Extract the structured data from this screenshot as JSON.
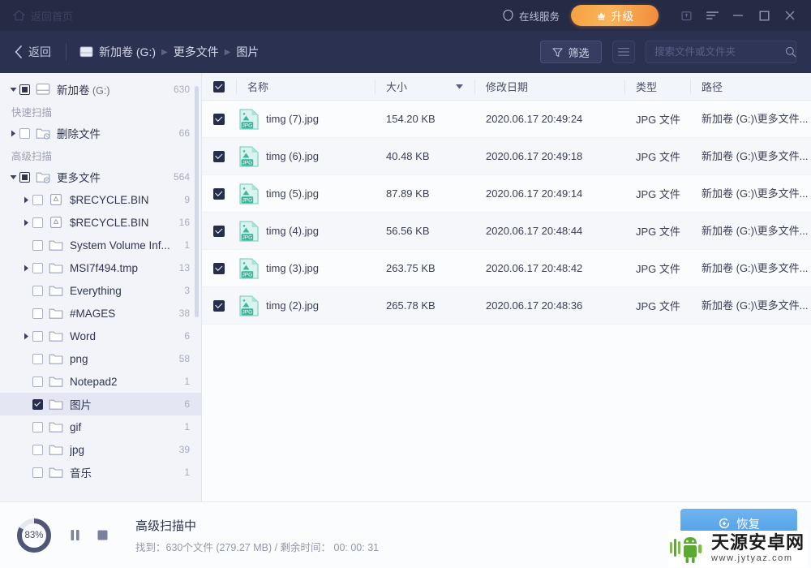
{
  "titlebar": {
    "home_label": "返回首页",
    "home_icon": "home-icon",
    "service_label": "在线服务",
    "service_icon": "headset-icon",
    "upgrade_label": "升级",
    "upgrade_icon": "crown-upgrade-icon",
    "window_buttons": [
      {
        "name": "feedback-icon",
        "label": ""
      },
      {
        "name": "menu-icon",
        "label": ""
      },
      {
        "name": "minimize-icon",
        "label": ""
      },
      {
        "name": "maximize-icon",
        "label": ""
      },
      {
        "name": "close-icon",
        "label": ""
      }
    ]
  },
  "navbar": {
    "back_label": "返回",
    "back_icon": "chevron-left-icon",
    "drive_icon": "drive-icon",
    "breadcrumbs": [
      "新加卷 (G:)",
      "更多文件",
      "图片"
    ],
    "separator": "▸",
    "filter_label": "筛选",
    "filter_icon": "funnel-icon",
    "viewmode_icon": "list-view-icon",
    "search_placeholder": "搜索文件或文件夹",
    "search_value": "",
    "search_icon": "search-icon"
  },
  "sidebar": {
    "scroll_thumb": true,
    "nodes": [
      {
        "type": "node",
        "indent": 0,
        "caret": "down",
        "check": "partial",
        "icon": "drive-icon",
        "label": "新加卷",
        "sub": " (G:)",
        "count": "630",
        "selected": false
      },
      {
        "type": "section",
        "label": "快速扫描"
      },
      {
        "type": "node",
        "indent": 0,
        "caret": "right",
        "check": "none",
        "icon": "deleted-folder-icon",
        "label": "删除文件",
        "sub": "",
        "count": "66",
        "selected": false
      },
      {
        "type": "section",
        "label": "高级扫描"
      },
      {
        "type": "node",
        "indent": 0,
        "caret": "down",
        "check": "partial",
        "icon": "more-folder-icon",
        "label": "更多文件",
        "sub": "",
        "count": "564",
        "selected": false
      },
      {
        "type": "node",
        "indent": 1,
        "caret": "right",
        "check": "none",
        "icon": "recycle-icon",
        "label": "$RECYCLE.BIN",
        "sub": "",
        "count": "9",
        "selected": false
      },
      {
        "type": "node",
        "indent": 1,
        "caret": "right",
        "check": "none",
        "icon": "recycle-icon",
        "label": "$RECYCLE.BIN",
        "sub": "",
        "count": "16",
        "selected": false
      },
      {
        "type": "node",
        "indent": 1,
        "caret": "none",
        "check": "none",
        "icon": "folder-icon",
        "label": "System Volume Inf...",
        "sub": "",
        "count": "1",
        "selected": false
      },
      {
        "type": "node",
        "indent": 1,
        "caret": "right",
        "check": "none",
        "icon": "folder-icon",
        "label": "MSI7f494.tmp",
        "sub": "",
        "count": "13",
        "selected": false
      },
      {
        "type": "node",
        "indent": 1,
        "caret": "none",
        "check": "none",
        "icon": "folder-icon",
        "label": "Everything",
        "sub": "",
        "count": "3",
        "selected": false
      },
      {
        "type": "node",
        "indent": 1,
        "caret": "none",
        "check": "none",
        "icon": "folder-icon",
        "label": "#MAGES",
        "sub": "",
        "count": "38",
        "selected": false
      },
      {
        "type": "node",
        "indent": 1,
        "caret": "right",
        "check": "none",
        "icon": "folder-icon",
        "label": "Word",
        "sub": "",
        "count": "6",
        "selected": false
      },
      {
        "type": "node",
        "indent": 1,
        "caret": "none",
        "check": "none",
        "icon": "folder-icon",
        "label": "png",
        "sub": "",
        "count": "58",
        "selected": false
      },
      {
        "type": "node",
        "indent": 1,
        "caret": "none",
        "check": "none",
        "icon": "folder-icon",
        "label": "Notepad2",
        "sub": "",
        "count": "1",
        "selected": false
      },
      {
        "type": "node",
        "indent": 1,
        "caret": "none",
        "check": "checked",
        "icon": "folder-icon",
        "label": "图片",
        "sub": "",
        "count": "6",
        "selected": true
      },
      {
        "type": "node",
        "indent": 1,
        "caret": "none",
        "check": "none",
        "icon": "folder-icon",
        "label": "gif",
        "sub": "",
        "count": "1",
        "selected": false
      },
      {
        "type": "node",
        "indent": 1,
        "caret": "none",
        "check": "none",
        "icon": "folder-icon",
        "label": "jpg",
        "sub": "",
        "count": "39",
        "selected": false
      },
      {
        "type": "node",
        "indent": 1,
        "caret": "none",
        "check": "none",
        "icon": "folder-icon",
        "label": "音乐",
        "sub": "",
        "count": "1",
        "selected": false
      }
    ]
  },
  "table": {
    "header_checked": true,
    "columns": {
      "name": "名称",
      "size": "大小",
      "date": "修改日期",
      "type": "类型",
      "path": "路径"
    },
    "sort_icon": "sort-descending-caret",
    "rows": [
      {
        "checked": true,
        "icon": "jpg-file-icon",
        "name": "timg (7).jpg",
        "size": "154.20 KB",
        "date": "2020.06.17 20:49:24",
        "type": "JPG 文件",
        "path": "新加卷 (G:)\\更多文件..."
      },
      {
        "checked": true,
        "icon": "jpg-file-icon",
        "name": "timg (6).jpg",
        "size": "40.48 KB",
        "date": "2020.06.17 20:49:18",
        "type": "JPG 文件",
        "path": "新加卷 (G:)\\更多文件..."
      },
      {
        "checked": true,
        "icon": "jpg-file-icon",
        "name": "timg (5).jpg",
        "size": "87.89 KB",
        "date": "2020.06.17 20:49:14",
        "type": "JPG 文件",
        "path": "新加卷 (G:)\\更多文件..."
      },
      {
        "checked": true,
        "icon": "jpg-file-icon",
        "name": "timg (4).jpg",
        "size": "56.56 KB",
        "date": "2020.06.17 20:48:44",
        "type": "JPG 文件",
        "path": "新加卷 (G:)\\更多文件..."
      },
      {
        "checked": true,
        "icon": "jpg-file-icon",
        "name": "timg (3).jpg",
        "size": "263.75 KB",
        "date": "2020.06.17 20:48:42",
        "type": "JPG 文件",
        "path": "新加卷 (G:)\\更多文件..."
      },
      {
        "checked": true,
        "icon": "jpg-file-icon",
        "name": "timg (2).jpg",
        "size": "265.78 KB",
        "date": "2020.06.17 20:48:36",
        "type": "JPG 文件",
        "path": "新加卷 (G:)\\更多文件..."
      }
    ]
  },
  "statusbar": {
    "progress_percent": "83%",
    "progress_value": 83,
    "pause_icon": "pause-icon",
    "stop_icon": "stop-icon",
    "title": "高级扫描中",
    "subtitle": "找到：630个文件 (279.27 MB) / 剩余时间：  00: 00: 31",
    "recover_label": "恢复",
    "recover_icon": "recover-icon"
  },
  "watermark": {
    "logo_icon": "android-robot-icon",
    "site_name": "天源安卓网",
    "site_url": "www.jytyaz.com"
  },
  "colors": {
    "titlebar_bg": "#262b45",
    "navbar_bg": "#2b3150",
    "accent_orange": "#f5a13f",
    "accent_blue": "#4f9fe6",
    "sidebar_bg": "#f2f4f9",
    "jpg_icon": "#3fb8a0",
    "watermark_green": "#5aaa32"
  }
}
